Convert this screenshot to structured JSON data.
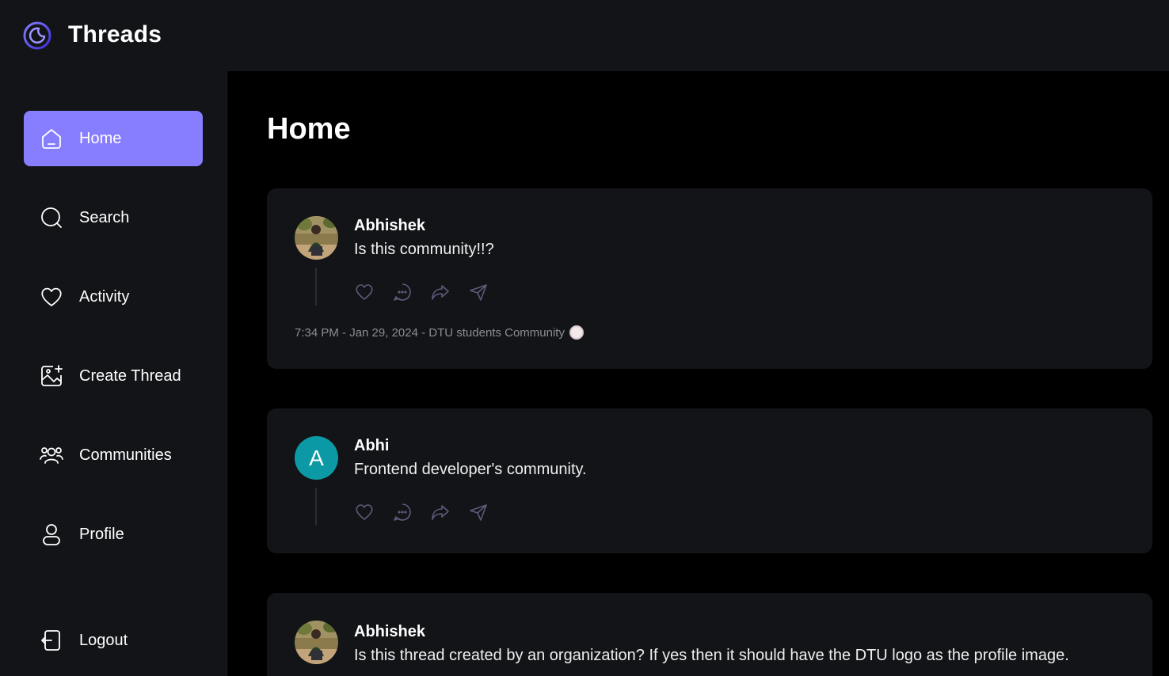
{
  "app": {
    "title": "Threads"
  },
  "sidebar": {
    "items": [
      {
        "label": "Home",
        "icon": "home-icon",
        "active": true
      },
      {
        "label": "Search",
        "icon": "search-icon",
        "active": false
      },
      {
        "label": "Activity",
        "icon": "heart-icon",
        "active": false
      },
      {
        "label": "Create Thread",
        "icon": "image-plus-icon",
        "active": false
      },
      {
        "label": "Communities",
        "icon": "users-icon",
        "active": false
      },
      {
        "label": "Profile",
        "icon": "user-icon",
        "active": false
      }
    ],
    "logout_label": "Logout"
  },
  "main": {
    "title": "Home",
    "threads": [
      {
        "author": "Abhishek",
        "avatar": "photo",
        "text": "Is this community!!?",
        "meta": "7:34 PM - Jan 29, 2024 - DTU students Community"
      },
      {
        "author": "Abhi",
        "avatar": "letter",
        "avatar_letter": "A",
        "text": "Frontend developer's community."
      },
      {
        "author": "Abhishek",
        "avatar": "photo",
        "text": "Is this thread created by an organization? If yes then it should have the DTU logo as the profile image."
      }
    ]
  },
  "colors": {
    "accent": "#877eff",
    "sidebar_bg": "#121417",
    "card_bg": "#121417",
    "main_bg": "#000000",
    "letter_avatar_bg": "#0b9aa5"
  }
}
